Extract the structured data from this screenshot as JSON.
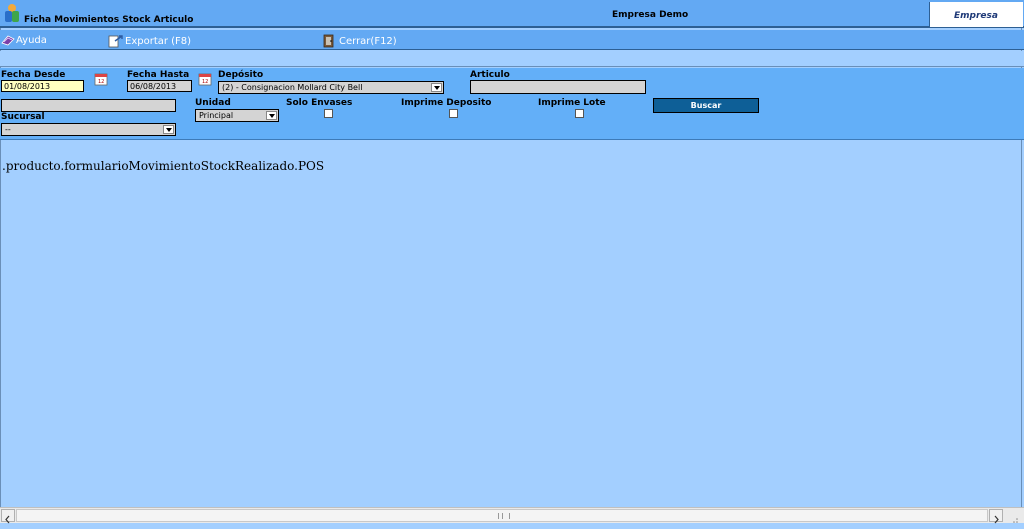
{
  "window": {
    "title": "Ficha Movimientos Stock Articulo",
    "company": "Empresa Demo",
    "empresa_tab": "Empresa"
  },
  "menu": {
    "ayuda": "Ayuda",
    "exportar": "Exportar (F8)",
    "cerrar": "Cerrar(F12)"
  },
  "filters": {
    "fecha_desde_label": "Fecha Desde",
    "fecha_desde_value": "01/08/2013",
    "fecha_hasta_label": "Fecha Hasta",
    "fecha_hasta_value": "06/08/2013",
    "deposito_label": "Depósito",
    "deposito_value": "(2) - Consignacion Mollard City Bell",
    "articulo_label": "Articulo",
    "articulo_value": "",
    "unidad_label": "Unidad",
    "unidad_value": "Principal",
    "solo_envases_label": "Solo Envases",
    "imprime_deposito_label": "Imprime Deposito",
    "imprime_lote_label": "Imprime Lote",
    "sucursal_label": "Sucursal",
    "sucursal_value": "--",
    "buscar_label": "Buscar"
  },
  "content": {
    "message": ".producto.formularioMovimientoStockRealizado.POS"
  },
  "colors": {
    "bar": "#63a9f3",
    "panel": "#63aff8",
    "content_bg": "#a3cfff",
    "button": "#0e5f97"
  }
}
